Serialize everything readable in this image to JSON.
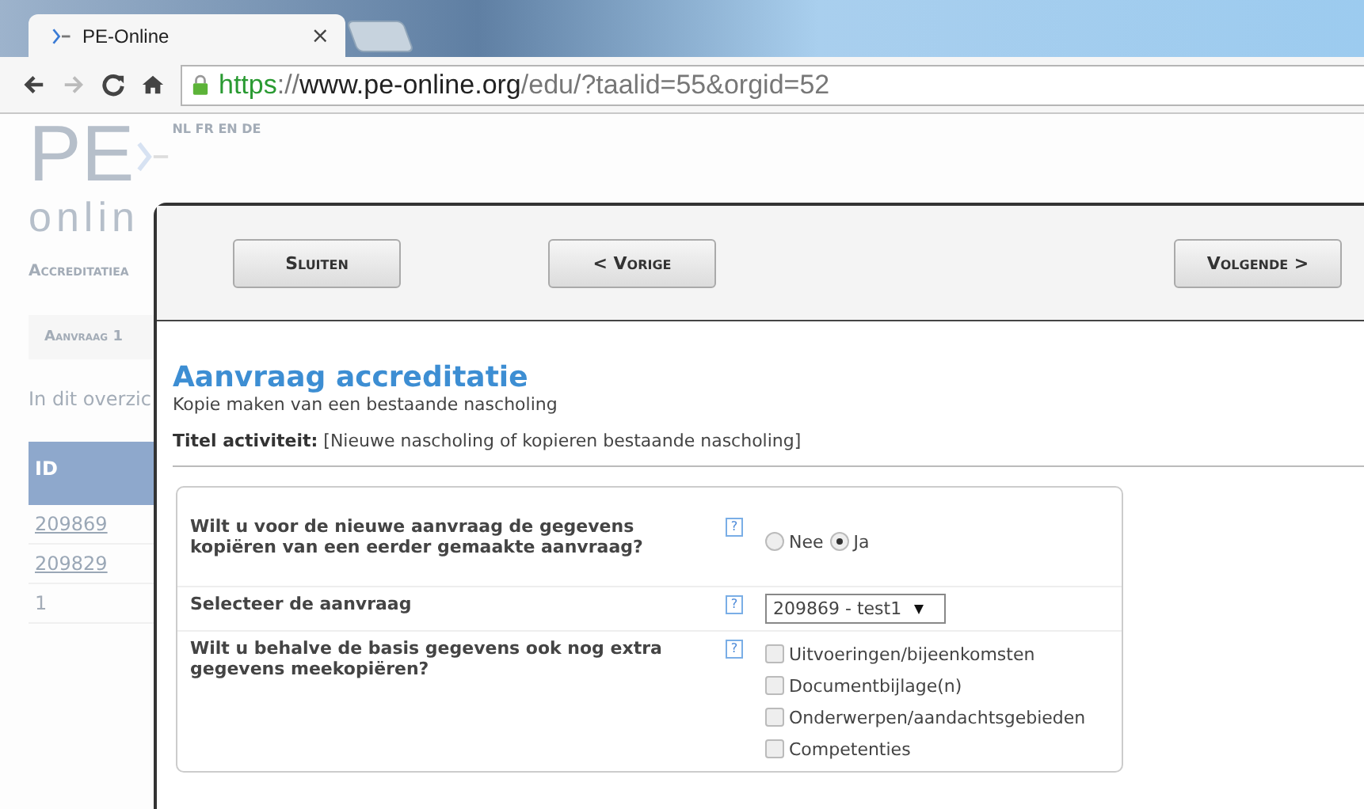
{
  "browser": {
    "tab": {
      "title": "PE-Online",
      "close": "×"
    },
    "url": {
      "scheme": "https",
      "separator": "://",
      "host": "www.pe-online.org",
      "path": "/edu/?taalid=55&orgid=52"
    }
  },
  "background_page": {
    "logo": [
      "PE",
      "onlin"
    ],
    "languages": "NL FR EN DE",
    "heading": "Accreditatiea",
    "button": "Aanvraag 1",
    "intro": "In dit overzic",
    "table": {
      "columns": [
        "ID"
      ],
      "rows": [
        "209869",
        "209829",
        "1"
      ]
    }
  },
  "dialog": {
    "buttons": [
      {
        "label": "Sluiten",
        "kind": "close"
      },
      {
        "label": "< Vorige",
        "kind": "prev"
      },
      {
        "label": "Volgende >",
        "kind": "next"
      }
    ],
    "title": "Aanvraag accreditatie",
    "subtitle": "Kopie maken van een bestaande nascholing",
    "activity": {
      "label": "Titel activiteit:",
      "value": "[Nieuwe nascholing of kopieren bestaande nascholing]"
    },
    "form": {
      "rows": [
        {
          "kind": "radio",
          "label": "Wilt u voor de nieuwe aanvraag de gegevens kopiëren van een eerder gemaakte aanvraag?",
          "help": "?",
          "options": [
            {
              "label": "Nee",
              "selected": false
            },
            {
              "label": "Ja",
              "selected": true
            }
          ]
        },
        {
          "kind": "select",
          "label": "Selecteer de aanvraag",
          "help": "?",
          "value": "209869 - test1"
        },
        {
          "kind": "checkboxes",
          "label": "Wilt u behalve de basis gegevens ook nog extra gegevens meekopiëren?",
          "help": "?",
          "options": [
            {
              "label": "Uitvoeringen/bijeenkomsten",
              "checked": false
            },
            {
              "label": "Documentbijlage(n)",
              "checked": false
            },
            {
              "label": "Onderwerpen/aandachtsgebieden",
              "checked": false
            },
            {
              "label": "Competenties",
              "checked": false
            }
          ]
        }
      ]
    }
  }
}
